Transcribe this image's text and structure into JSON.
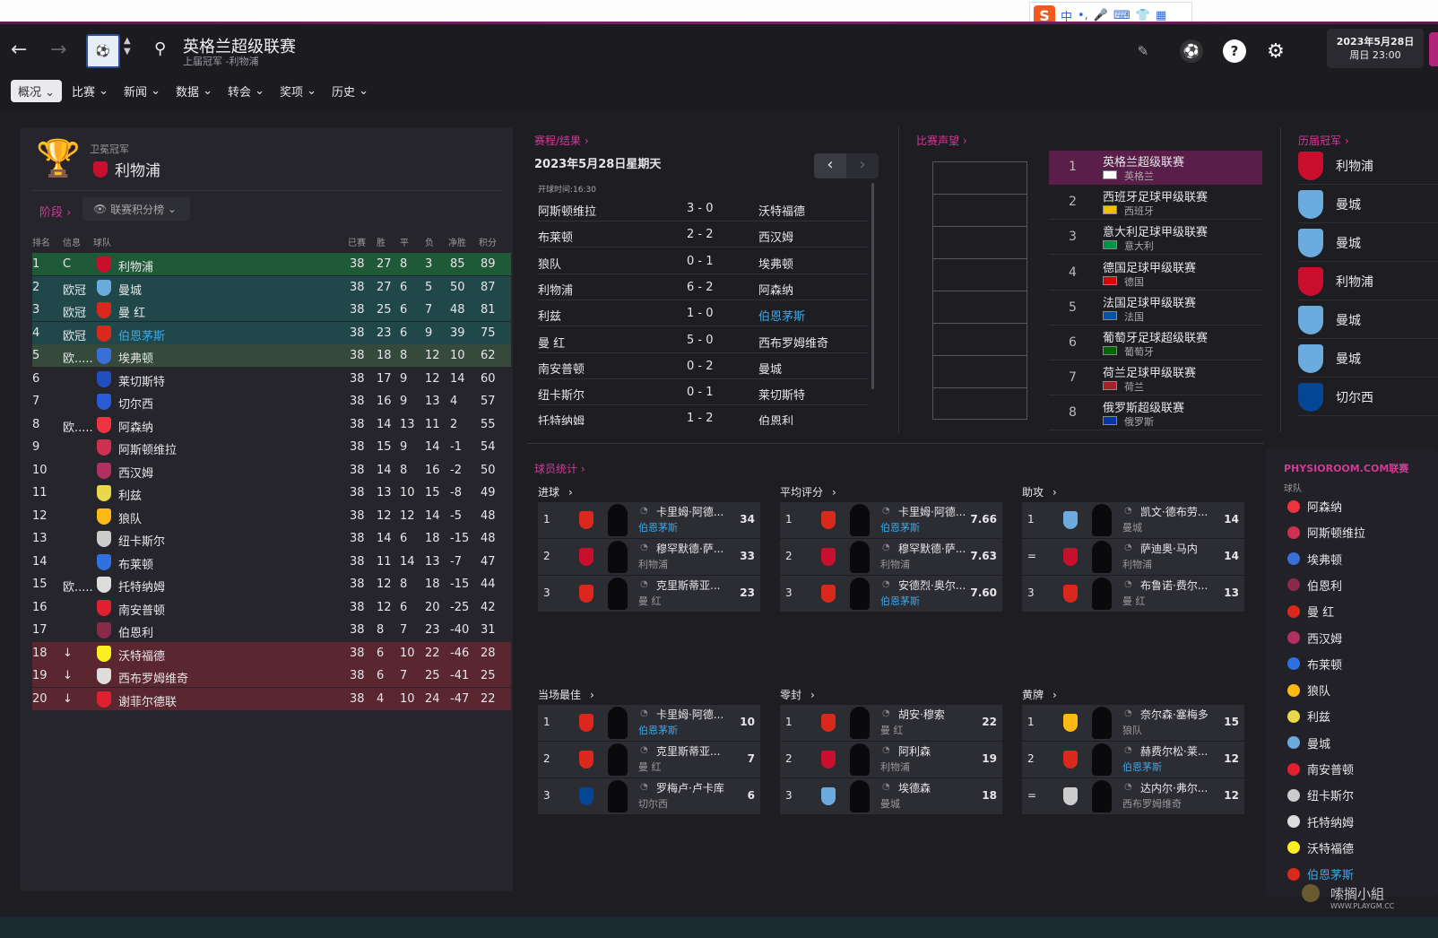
{
  "ime": {
    "logo": "S",
    "items": [
      "中",
      "•,",
      "🎤",
      "⌨",
      "👕",
      "▦"
    ]
  },
  "header": {
    "title": "英格兰超级联赛",
    "subtitle": "上届冠军 -利物浦",
    "date": "2023年5月28日",
    "time": "周日 23:00",
    "back": "←",
    "forward": "→",
    "search": "⚲",
    "edit": "✎",
    "help": "?",
    "settings": "⚙",
    "ball": "⚽"
  },
  "menu": [
    "概况",
    "比赛",
    "新闻",
    "数据",
    "转会",
    "奖项",
    "历史"
  ],
  "champion": {
    "label": "卫冕冠军",
    "team": "利物浦"
  },
  "stage": {
    "label": "阶段",
    "select": "联赛积分榜"
  },
  "table": {
    "headers": [
      "排名",
      "信息",
      "球队",
      "已赛",
      "胜",
      "平",
      "负",
      "净胜",
      "积分"
    ],
    "rows": [
      {
        "pos": "1",
        "info": "C",
        "team": "利物浦",
        "p": "38",
        "w": "27",
        "d": "8",
        "l": "3",
        "gd": "85",
        "pts": "89",
        "color": "#c8102e"
      },
      {
        "pos": "2",
        "info": "欧冠",
        "team": "曼城",
        "p": "38",
        "w": "27",
        "d": "6",
        "l": "5",
        "gd": "50",
        "pts": "87",
        "color": "#6cabdd"
      },
      {
        "pos": "3",
        "info": "欧冠",
        "team": "曼 红",
        "p": "38",
        "w": "25",
        "d": "6",
        "l": "7",
        "gd": "48",
        "pts": "81",
        "color": "#da291c"
      },
      {
        "pos": "4",
        "info": "欧冠",
        "team": "伯恩茅斯",
        "p": "38",
        "w": "23",
        "d": "6",
        "l": "9",
        "gd": "39",
        "pts": "75",
        "color": "#da291c"
      },
      {
        "pos": "5",
        "info": "欧.....",
        "team": "埃弗顿",
        "p": "38",
        "w": "18",
        "d": "8",
        "l": "12",
        "gd": "10",
        "pts": "62",
        "color": "#3a6fd8"
      },
      {
        "pos": "6",
        "info": "",
        "team": "莱切斯特",
        "p": "38",
        "w": "17",
        "d": "9",
        "l": "12",
        "gd": "14",
        "pts": "60",
        "color": "#2050c0"
      },
      {
        "pos": "7",
        "info": "",
        "team": "切尔西",
        "p": "38",
        "w": "16",
        "d": "9",
        "l": "13",
        "gd": "4",
        "pts": "57",
        "color": "#2a5bd7"
      },
      {
        "pos": "8",
        "info": "欧.....",
        "team": "阿森纳",
        "p": "38",
        "w": "14",
        "d": "13",
        "l": "11",
        "gd": "2",
        "pts": "55",
        "color": "#ef3340"
      },
      {
        "pos": "9",
        "info": "",
        "team": "阿斯顿维拉",
        "p": "38",
        "w": "15",
        "d": "9",
        "l": "14",
        "gd": "-1",
        "pts": "54",
        "color": "#d03050"
      },
      {
        "pos": "10",
        "info": "",
        "team": "西汉姆",
        "p": "38",
        "w": "14",
        "d": "8",
        "l": "16",
        "gd": "-2",
        "pts": "50",
        "color": "#b03060"
      },
      {
        "pos": "11",
        "info": "",
        "team": "利兹",
        "p": "38",
        "w": "13",
        "d": "10",
        "l": "15",
        "gd": "-8",
        "pts": "49",
        "color": "#e8d84a"
      },
      {
        "pos": "12",
        "info": "",
        "team": "狼队",
        "p": "38",
        "w": "12",
        "d": "12",
        "l": "14",
        "gd": "-5",
        "pts": "48",
        "color": "#fdb913"
      },
      {
        "pos": "13",
        "info": "",
        "team": "纽卡斯尔",
        "p": "38",
        "w": "14",
        "d": "6",
        "l": "18",
        "gd": "-15",
        "pts": "48",
        "color": "#cccccc"
      },
      {
        "pos": "14",
        "info": "",
        "team": "布莱顿",
        "p": "38",
        "w": "11",
        "d": "14",
        "l": "13",
        "gd": "-7",
        "pts": "47",
        "color": "#3070e0"
      },
      {
        "pos": "15",
        "info": "欧.....",
        "team": "托特纳姆",
        "p": "38",
        "w": "12",
        "d": "8",
        "l": "18",
        "gd": "-15",
        "pts": "44",
        "color": "#dddddd"
      },
      {
        "pos": "16",
        "info": "",
        "team": "南安普顿",
        "p": "38",
        "w": "12",
        "d": "6",
        "l": "20",
        "gd": "-25",
        "pts": "42",
        "color": "#e02030"
      },
      {
        "pos": "17",
        "info": "",
        "team": "伯恩利",
        "p": "38",
        "w": "8",
        "d": "7",
        "l": "23",
        "gd": "-40",
        "pts": "31",
        "color": "#8a2a4a"
      },
      {
        "pos": "18",
        "info": "↓",
        "team": "沃特福德",
        "p": "38",
        "w": "6",
        "d": "10",
        "l": "22",
        "gd": "-46",
        "pts": "28",
        "color": "#fbee23"
      },
      {
        "pos": "19",
        "info": "↓",
        "team": "西布罗姆维奇",
        "p": "38",
        "w": "6",
        "d": "7",
        "l": "25",
        "gd": "-41",
        "pts": "25",
        "color": "#dddddd"
      },
      {
        "pos": "20",
        "info": "↓",
        "team": "谢菲尔德联",
        "p": "38",
        "w": "4",
        "d": "10",
        "l": "24",
        "gd": "-47",
        "pts": "22",
        "color": "#e02030"
      }
    ]
  },
  "fixtures": {
    "section": "赛程/结果",
    "date": "2023年5月28日星期天",
    "kickoff": "开球时间:16:30",
    "prev": "‹",
    "next": "›",
    "rows": [
      {
        "home": "阿斯顿维拉",
        "score": "3 - 0",
        "away": "沃特福德"
      },
      {
        "home": "布莱顿",
        "score": "2 - 2",
        "away": "西汉姆"
      },
      {
        "home": "狼队",
        "score": "0 - 1",
        "away": "埃弗顿"
      },
      {
        "home": "利物浦",
        "score": "6 - 2",
        "away": "阿森纳"
      },
      {
        "home": "利兹",
        "score": "1 - 0",
        "away": "伯恩茅斯"
      },
      {
        "home": "曼 红",
        "score": "5 - 0",
        "away": "西布罗姆维奇"
      },
      {
        "home": "南安普顿",
        "score": "0 - 2",
        "away": "曼城"
      },
      {
        "home": "纽卡斯尔",
        "score": "0 - 1",
        "away": "莱切斯特"
      },
      {
        "home": "托特纳姆",
        "score": "1 - 2",
        "away": "伯恩利"
      }
    ]
  },
  "reputation": {
    "section": "比赛声望",
    "rows": [
      {
        "rank": "1",
        "name": "英格兰超级联赛",
        "country": "英格兰",
        "flag": "#ffffff"
      },
      {
        "rank": "2",
        "name": "西班牙足球甲级联赛",
        "country": "西班牙",
        "flag": "#f1bf00"
      },
      {
        "rank": "3",
        "name": "意大利足球甲级联赛",
        "country": "意大利",
        "flag": "#009246"
      },
      {
        "rank": "4",
        "name": "德国足球甲级联赛",
        "country": "德国",
        "flag": "#dd0000"
      },
      {
        "rank": "5",
        "name": "法国足球甲级联赛",
        "country": "法国",
        "flag": "#0055a4"
      },
      {
        "rank": "6",
        "name": "葡萄牙足球超级联赛",
        "country": "葡萄牙",
        "flag": "#006600"
      },
      {
        "rank": "7",
        "name": "荷兰足球甲级联赛",
        "country": "荷兰",
        "flag": "#ae1c28"
      },
      {
        "rank": "8",
        "name": "俄罗斯超级联赛",
        "country": "俄罗斯",
        "flag": "#0039a6"
      }
    ]
  },
  "champions": {
    "section": "历届冠军",
    "rows": [
      {
        "team": "利物浦",
        "color": "#c8102e"
      },
      {
        "team": "曼城",
        "color": "#6cabdd"
      },
      {
        "team": "曼城",
        "color": "#6cabdd"
      },
      {
        "team": "利物浦",
        "color": "#c8102e"
      },
      {
        "team": "曼城",
        "color": "#6cabdd"
      },
      {
        "team": "曼城",
        "color": "#6cabdd"
      },
      {
        "team": "切尔西",
        "color": "#034694"
      }
    ]
  },
  "stats": {
    "section": "球员统计",
    "groups": [
      {
        "title": "进球",
        "entries": [
          {
            "rank": "1",
            "name": "卡里姆·阿德...",
            "club": "伯恩茅斯",
            "value": "34",
            "color": "#da291c",
            "clubBlue": true
          },
          {
            "rank": "2",
            "name": "穆罕默德·萨...",
            "club": "利物浦",
            "value": "33",
            "color": "#c8102e",
            "clubBlue": false
          },
          {
            "rank": "3",
            "name": "克里斯蒂亚...",
            "club": "曼 红",
            "value": "23",
            "color": "#da291c",
            "clubBlue": false
          }
        ]
      },
      {
        "title": "平均评分",
        "entries": [
          {
            "rank": "1",
            "name": "卡里姆·阿德...",
            "club": "伯恩茅斯",
            "value": "7.66",
            "color": "#da291c",
            "clubBlue": true
          },
          {
            "rank": "2",
            "name": "穆罕默德·萨...",
            "club": "利物浦",
            "value": "7.63",
            "color": "#c8102e",
            "clubBlue": false
          },
          {
            "rank": "3",
            "name": "安德烈·奥尔...",
            "club": "伯恩茅斯",
            "value": "7.60",
            "color": "#da291c",
            "clubBlue": true
          }
        ]
      },
      {
        "title": "助攻",
        "entries": [
          {
            "rank": "1",
            "name": "凯文·德布劳...",
            "club": "曼城",
            "value": "14",
            "color": "#6cabdd",
            "clubBlue": false
          },
          {
            "rank": "=",
            "name": "萨迪奥·马内",
            "club": "利物浦",
            "value": "14",
            "color": "#c8102e",
            "clubBlue": false
          },
          {
            "rank": "3",
            "name": "布鲁诺·费尔...",
            "club": "曼 红",
            "value": "13",
            "color": "#da291c",
            "clubBlue": false
          }
        ]
      },
      {
        "title": "当场最佳",
        "entries": [
          {
            "rank": "1",
            "name": "卡里姆·阿德...",
            "club": "伯恩茅斯",
            "value": "10",
            "color": "#da291c",
            "clubBlue": true
          },
          {
            "rank": "2",
            "name": "克里斯蒂亚...",
            "club": "曼 红",
            "value": "7",
            "color": "#da291c",
            "clubBlue": false
          },
          {
            "rank": "3",
            "name": "罗梅卢·卢卡库",
            "club": "切尔西",
            "value": "6",
            "color": "#034694",
            "clubBlue": false
          }
        ]
      },
      {
        "title": "零封",
        "entries": [
          {
            "rank": "1",
            "name": "胡安·穆索",
            "club": "曼 红",
            "value": "22",
            "color": "#da291c",
            "clubBlue": false
          },
          {
            "rank": "2",
            "name": "阿利森",
            "club": "利物浦",
            "value": "19",
            "color": "#c8102e",
            "clubBlue": false
          },
          {
            "rank": "3",
            "name": "埃德森",
            "club": "曼城",
            "value": "18",
            "color": "#6cabdd",
            "clubBlue": false
          }
        ]
      },
      {
        "title": "黄牌",
        "entries": [
          {
            "rank": "1",
            "name": "奈尔森·塞梅多",
            "club": "狼队",
            "value": "15",
            "color": "#fdb913",
            "clubBlue": false
          },
          {
            "rank": "2",
            "name": "赫费尔松·莱...",
            "club": "伯恩茅斯",
            "value": "12",
            "color": "#da291c",
            "clubBlue": true
          },
          {
            "rank": "=",
            "name": "达内尔·弗尔...",
            "club": "西布罗姆维奇",
            "value": "12",
            "color": "#cccccc",
            "clubBlue": false
          }
        ]
      }
    ]
  },
  "physio": {
    "title": "PHYSIOROOM.COM联赛",
    "label": "球队",
    "teams": [
      {
        "team": "阿森纳",
        "color": "#ef3340",
        "blue": false
      },
      {
        "team": "阿斯顿维拉",
        "color": "#d03050",
        "blue": false
      },
      {
        "team": "埃弗顿",
        "color": "#3a6fd8",
        "blue": false
      },
      {
        "team": "伯恩利",
        "color": "#8a2a4a",
        "blue": false
      },
      {
        "team": "曼 红",
        "color": "#da291c",
        "blue": false
      },
      {
        "team": "西汉姆",
        "color": "#b03060",
        "blue": false
      },
      {
        "team": "布莱顿",
        "color": "#3070e0",
        "blue": false
      },
      {
        "team": "狼队",
        "color": "#fdb913",
        "blue": false
      },
      {
        "team": "利兹",
        "color": "#e8d84a",
        "blue": false
      },
      {
        "team": "曼城",
        "color": "#6cabdd",
        "blue": false
      },
      {
        "team": "南安普顿",
        "color": "#e02030",
        "blue": false
      },
      {
        "team": "纽卡斯尔",
        "color": "#cccccc",
        "blue": false
      },
      {
        "team": "托特纳姆",
        "color": "#dddddd",
        "blue": false
      },
      {
        "team": "沃特福德",
        "color": "#fbee23",
        "blue": false
      },
      {
        "team": "伯恩茅斯",
        "color": "#da291c",
        "blue": true
      }
    ]
  },
  "watermark": {
    "main": "嗦搁小組",
    "sub": "WWW.PLAYGM.CC"
  }
}
